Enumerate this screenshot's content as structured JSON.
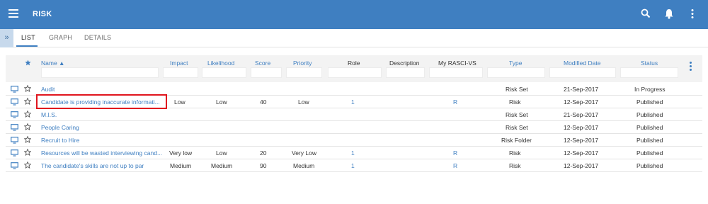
{
  "app": {
    "title": "RISK"
  },
  "tabs": [
    {
      "label": "LIST",
      "active": true
    },
    {
      "label": "GRAPH",
      "active": false
    },
    {
      "label": "DETAILS",
      "active": false
    }
  ],
  "expand_glyph": "»",
  "columns": {
    "name": "Name ▲",
    "impact": "Impact",
    "likelihood": "Likelihood",
    "score": "Score",
    "priority": "Priority",
    "role": "Role",
    "description": "Description",
    "rasci": "My RASCI-VS",
    "type": "Type",
    "modified": "Modified Date",
    "status": "Status"
  },
  "rows": [
    {
      "name": "Audit",
      "impact": "",
      "likelihood": "",
      "score": "",
      "priority": "",
      "role": "",
      "rasci": "",
      "type": "Risk Set",
      "modified": "21-Sep-2017",
      "status": "In Progress"
    },
    {
      "name": "Candidate is providing inaccurate informati...",
      "impact": "Low",
      "likelihood": "Low",
      "score": "40",
      "priority": "Low",
      "role": "1",
      "rasci": "R",
      "type": "Risk",
      "modified": "12-Sep-2017",
      "status": "Published"
    },
    {
      "name": "M.I.S.",
      "impact": "",
      "likelihood": "",
      "score": "",
      "priority": "",
      "role": "",
      "rasci": "",
      "type": "Risk Set",
      "modified": "21-Sep-2017",
      "status": "Published"
    },
    {
      "name": "People Caring",
      "impact": "",
      "likelihood": "",
      "score": "",
      "priority": "",
      "role": "",
      "rasci": "",
      "type": "Risk Set",
      "modified": "12-Sep-2017",
      "status": "Published"
    },
    {
      "name": "Recruit to Hire",
      "impact": "",
      "likelihood": "",
      "score": "",
      "priority": "",
      "role": "",
      "rasci": "",
      "type": "Risk Folder",
      "modified": "12-Sep-2017",
      "status": "Published"
    },
    {
      "name": "Resources will be wasted interviewing cand...",
      "impact": "Very low",
      "likelihood": "Low",
      "score": "20",
      "priority": "Very Low",
      "role": "1",
      "rasci": "R",
      "type": "Risk",
      "modified": "12-Sep-2017",
      "status": "Published"
    },
    {
      "name": "The candidate's skills are not up to par",
      "impact": "Medium",
      "likelihood": "Medium",
      "score": "90",
      "priority": "Medium",
      "role": "1",
      "rasci": "R",
      "type": "Risk",
      "modified": "12-Sep-2017",
      "status": "Published"
    }
  ],
  "colors": {
    "appbar": "#3f7fc1",
    "link": "#3f7fc1",
    "highlight": "#e0151e"
  }
}
